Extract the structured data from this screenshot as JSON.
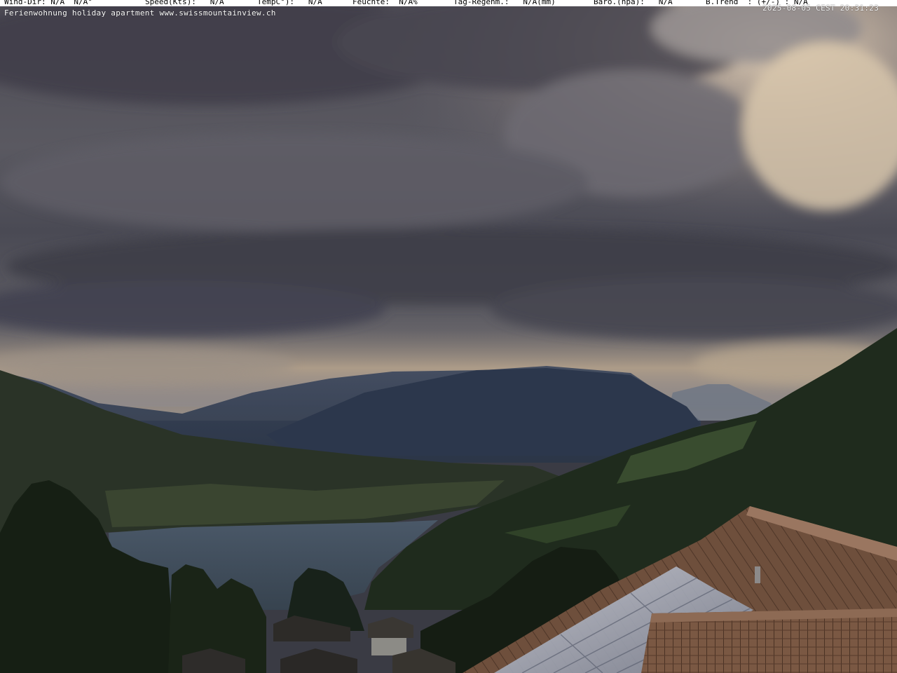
{
  "overlay": {
    "weather_items": [
      "Wind-Dir: N/A  N/A°",
      "Speed(Kts):   N/A",
      "TempC°):   N/A",
      "Feuchte:  N/A%",
      "Tag-Regenm.:   N/A(mm)",
      "Baro.(hpa):   N/A",
      "B.Trend  : (+/-) : N/A"
    ],
    "caption": "Ferienwohnung holiday apartment www.swissmountainview.ch",
    "timestamp": "2025-08-05 CEST 20:31:23"
  },
  "scene": {
    "subject": "lake-mountain-valley",
    "colors": {
      "sky_dark": "#45454f",
      "sky_warm": "#e8d3b4",
      "mountain": "#2f3a4f",
      "lake": "#3d4a5b",
      "forest": "#1c2618",
      "roof_tile": "#7a5a44",
      "solar_panel": "#9aa0b0"
    }
  }
}
